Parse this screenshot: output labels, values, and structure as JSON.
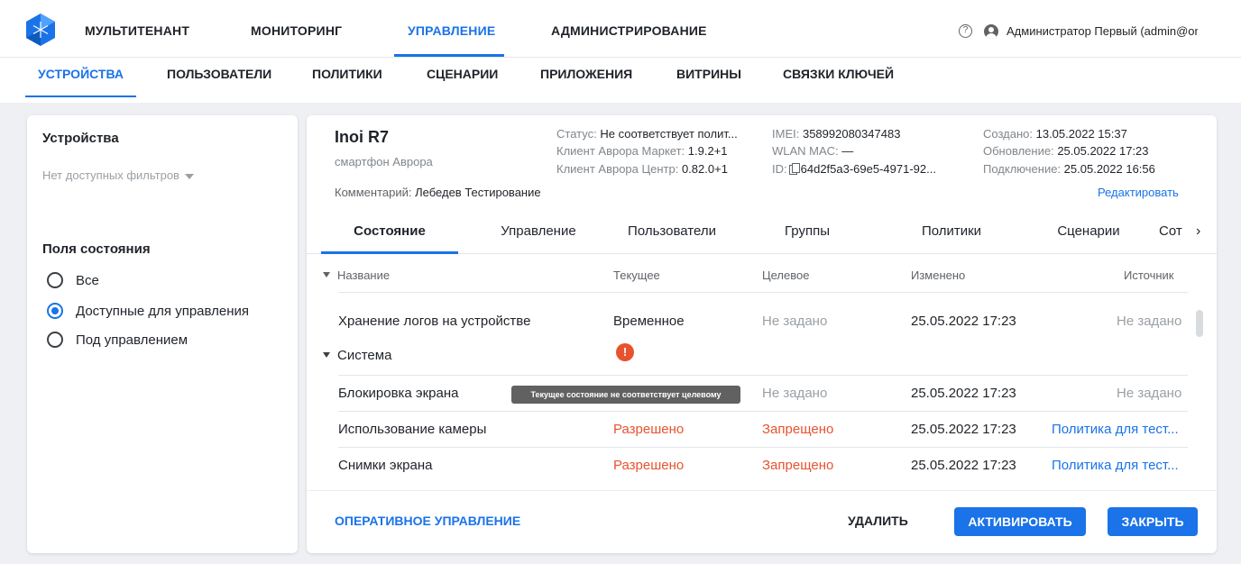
{
  "header": {
    "nav": [
      "МУЛЬТИТЕНАНТ",
      "МОНИТОРИНГ",
      "УПРАВЛЕНИЕ",
      "АДМИНИСТРИРОВАНИЕ"
    ],
    "active_nav": "УПРАВЛЕНИЕ",
    "help_glyph": "?",
    "user": "Администратор Первый (admin@omp..."
  },
  "subnav": {
    "items": [
      "УСТРОЙСТВА",
      "ПОЛЬЗОВАТЕЛИ",
      "ПОЛИТИКИ",
      "СЦЕНАРИИ",
      "ПРИЛОЖЕНИЯ",
      "ВИТРИНЫ",
      "СВЯЗКИ КЛЮЧЕЙ"
    ],
    "active": "УСТРОЙСТВА"
  },
  "left_panel": {
    "title": "Устройства",
    "filter_placeholder": "Нет доступных фильтров",
    "section_title": "Поля состояния",
    "radio_options": [
      "Все",
      "Доступные для управления",
      "Под управлением"
    ],
    "selected": "Доступные для управления"
  },
  "device": {
    "name": "Inoi R7",
    "type": "смартфон Аврора",
    "comment_label": "Комментарий:",
    "comment_value": "Лебедев Тестирование",
    "status_label": "Статус:",
    "status_value": "Не соответствует полит...",
    "market_label": "Клиент Аврора Маркет:",
    "market_value": "1.9.2+1",
    "center_label": "Клиент Аврора Центр:",
    "center_value": "0.82.0+1",
    "imei_label": "IMEI:",
    "imei_value": "358992080347483",
    "wlan_label": "WLAN MAC:",
    "wlan_value": "—",
    "id_label": "ID:",
    "id_value": "64d2f5a3-69e5-4971-92...",
    "created_label": "Создано:",
    "created_value": "13.05.2022 15:37",
    "updated_label": "Обновление:",
    "updated_value": "25.05.2022 17:23",
    "connected_label": "Подключение:",
    "connected_value": "25.05.2022 16:56",
    "edit_label": "Редактировать"
  },
  "tabs": {
    "items": [
      "Состояние",
      "Управление",
      "Пользователи",
      "Группы",
      "Политики",
      "Сценарии",
      "Сот"
    ],
    "active": "Состояние",
    "next_glyph": "›"
  },
  "table": {
    "columns": [
      "Название",
      "Текущее",
      "Целевое",
      "Изменено",
      "Источник"
    ],
    "rows_before_group": [
      {
        "name": "Хранение логов на устройстве",
        "current": "Временное",
        "target": "Не задано",
        "changed": "25.05.2022 17:23",
        "source": "Не задано"
      }
    ],
    "group": {
      "name": "Система",
      "warning_glyph": "!"
    },
    "rows": [
      {
        "name": "Блокировка экрана",
        "current": "",
        "target": "Не задано",
        "changed": "25.05.2022 17:23",
        "source": "Не задано"
      },
      {
        "name": "Использование камеры",
        "current": "Разрешено",
        "target": "Запрещено",
        "changed": "25.05.2022 17:23",
        "source": "Политика для тест..."
      },
      {
        "name": "Снимки экрана",
        "current": "Разрешено",
        "target": "Запрещено",
        "changed": "25.05.2022 17:23",
        "source": "Политика для тест..."
      }
    ],
    "tooltip": "Текущее состояние не соответствует целевому"
  },
  "footer": {
    "operative": "ОПЕРАТИВНОЕ УПРАВЛЕНИЕ",
    "delete": "УДАЛИТЬ",
    "activate": "АКТИВИРОВАТЬ",
    "close": "ЗАКРЫТЬ"
  },
  "colors": {
    "accent": "#1a73e8",
    "warning": "#e8532f",
    "muted": "#9aa0a6"
  }
}
